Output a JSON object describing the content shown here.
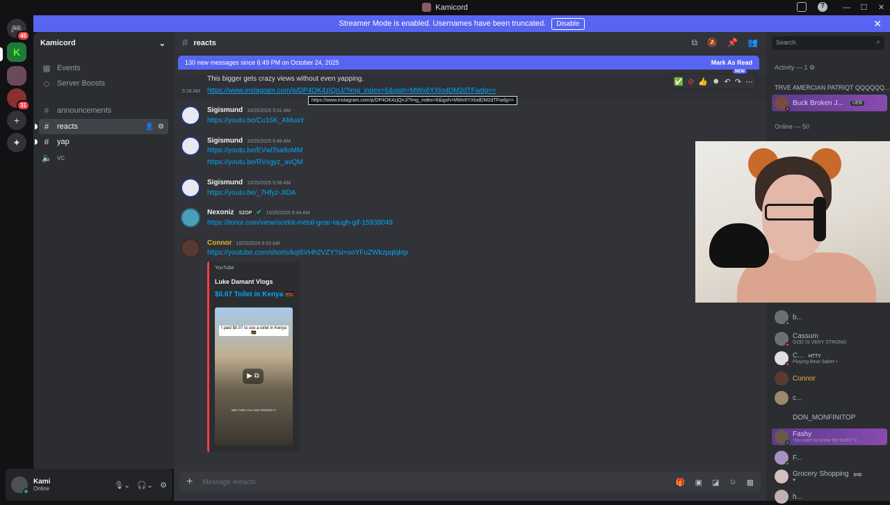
{
  "window": {
    "title": "Kamicord"
  },
  "servers": {
    "badges": [
      "45",
      "31"
    ]
  },
  "banner": {
    "text": "Streamer Mode is enabled. Usernames have been truncated.",
    "button": "Disable"
  },
  "sidebar": {
    "guild_name": "Kamicord",
    "items": [
      {
        "label": "Events",
        "icon": "calendar-icon"
      },
      {
        "label": "Server Boosts",
        "icon": "boost-icon"
      },
      {
        "label": "announcements",
        "icon": "hash-icon"
      },
      {
        "label": "reacts",
        "icon": "hash-icon"
      },
      {
        "label": "yap",
        "icon": "hash-icon"
      },
      {
        "label": "vc",
        "icon": "speaker-icon"
      }
    ]
  },
  "user_panel": {
    "name": "Kami",
    "status": "Online"
  },
  "channel": {
    "name": "reacts"
  },
  "new_messages_bar": {
    "text": "130 new messages since 6:49 PM on October 24, 2025",
    "action": "Mark As Read"
  },
  "messages": {
    "hovered": {
      "text": "This bigger gets crazy views without even yapping.",
      "timestamp": "5:18 AM",
      "link": "https://www.instagram.com/p/DP4OK4zjQnJ/?img_index=6&igsh=MWx6YXlodDM2dTFwdg==",
      "tooltip": "https://www.instagram.com/p/DP4OK4zjQnJ/?img_index=6&igsh=MWx6YXlodDM2dTFwdg==",
      "new_badge": "NEW"
    },
    "list": [
      {
        "author": "Sigismund",
        "time": "10/25/2025 5:31 AM",
        "lines": [
          "https://youtu.be/Cu16K_AMuaY"
        ]
      },
      {
        "author": "Sigismund",
        "time": "10/25/2025 5:49 AM",
        "lines": [
          "https://youtu.be/EVwlTsa9oMM",
          "https://youtu.be/RVxgyz_avQM"
        ]
      },
      {
        "author": "Sigismund",
        "time": "10/25/2025 5:58 AM",
        "lines": [
          "https://youtu.be/_7Hfyz-JIDA"
        ]
      },
      {
        "author": "Nexoniz",
        "tag": "SZOP",
        "time": "10/25/2025 6:44 AM",
        "lines": [
          "https://tenor.com/view/ocelot-metal-gear-laugh-gif-15938049"
        ]
      },
      {
        "author": "Connor",
        "time": "10/25/2025 6:53 AM",
        "lines": [
          "https://youtube.com/shorts/kqi6VHh2VZY?si=ooYFuZWkzpqlqktp"
        ]
      }
    ],
    "embed": {
      "provider": "YouTube",
      "author": "Luke Damant Vlogs",
      "title": "$0.07 Toilet in Kenya 🇰🇪",
      "thumb_caption": "I paid $0.07 to use a toilet in Kenya 🇰🇪",
      "thumb_subcaption": "AND THEN YOU CAN OPERATE IT"
    }
  },
  "composer": {
    "placeholder": "Message #reacts"
  },
  "members": {
    "search_placeholder": "Search",
    "activity_header": "Activity — 1",
    "activity_title": "TRVE AMERCIAN PATRIQT QQQQQQ...",
    "activity_member": "Buck Broken J...",
    "activity_tag": "UEB",
    "online_header": "Online — 50",
    "list": [
      {
        "name": "b...",
        "sub": ""
      },
      {
        "name": "Cassum",
        "sub": "GOD IS VERY STRONG"
      },
      {
        "name": "C...",
        "tag": "HTTY",
        "sub": "Playing Beat Saber •"
      },
      {
        "name": "Connor",
        "sub": ""
      },
      {
        "name": "c...",
        "sub": ""
      },
      {
        "name": "DON_MONFINITOP",
        "sub": ""
      },
      {
        "name": "Fashy",
        "sub": "You want to know the truth? Y..."
      },
      {
        "name": "F...",
        "sub": ""
      },
      {
        "name": "Grocery Shopping",
        "tag": "pup",
        "sub": ""
      },
      {
        "name": "h...",
        "sub": ""
      }
    ]
  },
  "colors": {
    "accent": "#5865f2",
    "link": "#00a8fc",
    "connor": "#e4b43a"
  }
}
